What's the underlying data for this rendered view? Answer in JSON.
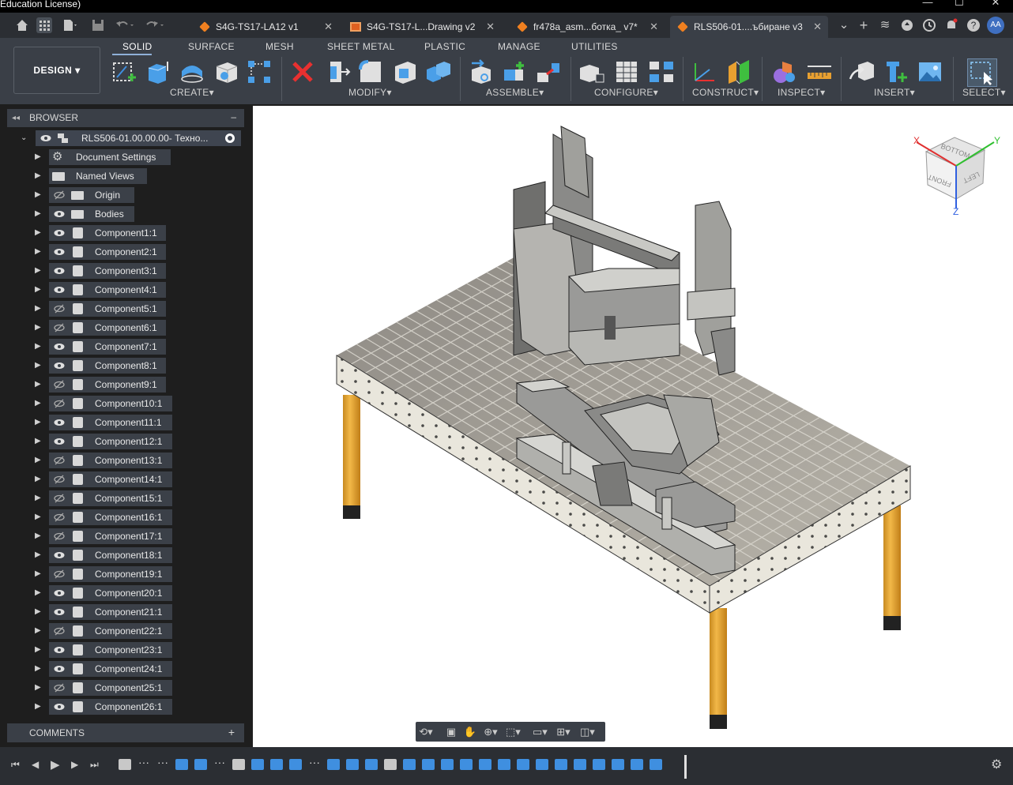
{
  "titlebar": {
    "title": "Education License)",
    "min": "—",
    "max": "☐",
    "close": "✕"
  },
  "tabs": [
    {
      "label": "S4G-TS17-LA12 v1",
      "kind": "model",
      "active": false
    },
    {
      "label": "S4G-TS17-L...Drawing v2",
      "kind": "drawing",
      "active": false
    },
    {
      "label": "fr478a_asm...ботка_ v7*",
      "kind": "model",
      "active": false
    },
    {
      "label": "RLS506-01....ъбиране v3",
      "kind": "model",
      "active": true
    }
  ],
  "user": {
    "initials": "AA"
  },
  "toolbar": {
    "design_label": "DESIGN",
    "workspace_tabs": [
      "SOLID",
      "SURFACE",
      "MESH",
      "SHEET METAL",
      "PLASTIC",
      "MANAGE",
      "UTILITIES"
    ],
    "groups": [
      "CREATE",
      "MODIFY",
      "ASSEMBLE",
      "CONFIGURE",
      "CONSTRUCT",
      "INSPECT",
      "INSERT",
      "SELECT"
    ]
  },
  "browser": {
    "title": "BROWSER",
    "root": "RLS506-01.00.00.00- Техно...",
    "items": [
      {
        "label": "Document Settings",
        "icon": "gear-icon",
        "visible": null
      },
      {
        "label": "Named Views",
        "icon": "folder-icon",
        "visible": null
      },
      {
        "label": "Origin",
        "icon": "folder-icon",
        "visible": false
      },
      {
        "label": "Bodies",
        "icon": "folder-icon",
        "visible": true
      },
      {
        "label": "Component1:1",
        "icon": "component-icon",
        "visible": true
      },
      {
        "label": "Component2:1",
        "icon": "component-icon",
        "visible": true
      },
      {
        "label": "Component3:1",
        "icon": "component-icon",
        "visible": true
      },
      {
        "label": "Component4:1",
        "icon": "component-icon",
        "visible": true
      },
      {
        "label": "Component5:1",
        "icon": "component-icon",
        "visible": false
      },
      {
        "label": "Component6:1",
        "icon": "component-icon",
        "visible": false
      },
      {
        "label": "Component7:1",
        "icon": "component-icon",
        "visible": true
      },
      {
        "label": "Component8:1",
        "icon": "component-icon",
        "visible": true
      },
      {
        "label": "Component9:1",
        "icon": "component-icon",
        "visible": false
      },
      {
        "label": "Component10:1",
        "icon": "component-icon",
        "visible": false
      },
      {
        "label": "Component11:1",
        "icon": "component-icon",
        "visible": true
      },
      {
        "label": "Component12:1",
        "icon": "component-icon",
        "visible": true
      },
      {
        "label": "Component13:1",
        "icon": "component-icon",
        "visible": false
      },
      {
        "label": "Component14:1",
        "icon": "component-icon",
        "visible": false
      },
      {
        "label": "Component15:1",
        "icon": "component-icon",
        "visible": false
      },
      {
        "label": "Component16:1",
        "icon": "component-icon",
        "visible": false
      },
      {
        "label": "Component17:1",
        "icon": "component-icon",
        "visible": false
      },
      {
        "label": "Component18:1",
        "icon": "component-icon",
        "visible": true
      },
      {
        "label": "Component19:1",
        "icon": "component-icon",
        "visible": false
      },
      {
        "label": "Component20:1",
        "icon": "component-icon",
        "visible": true
      },
      {
        "label": "Component21:1",
        "icon": "component-icon",
        "visible": true
      },
      {
        "label": "Component22:1",
        "icon": "component-icon",
        "visible": false
      },
      {
        "label": "Component23:1",
        "icon": "component-icon",
        "visible": true
      },
      {
        "label": "Component24:1",
        "icon": "component-icon",
        "visible": true
      },
      {
        "label": "Component25:1",
        "icon": "component-icon",
        "visible": false
      },
      {
        "label": "Component26:1",
        "icon": "component-icon",
        "visible": true
      }
    ]
  },
  "comments": {
    "title": "COMMENTS"
  },
  "viewcube": {
    "top": "BOTTOM",
    "front": "FRONT",
    "right": "LEFT",
    "x": "X",
    "y": "Y",
    "z": "Z"
  },
  "colors": {
    "accent": "#3f8fe0",
    "toolbar": "#3a3f47",
    "tabbar": "#2b2e33",
    "table_leg": "#e3a030"
  }
}
